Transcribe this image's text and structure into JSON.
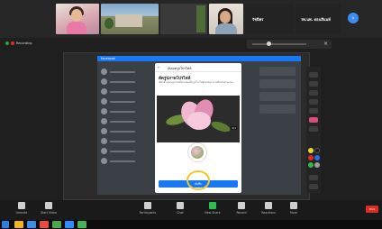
{
  "meeting": {
    "recording_label": "Recording",
    "participants": [
      {
        "name": "",
        "kind": "video"
      },
      {
        "name": "",
        "kind": "video"
      },
      {
        "name": "",
        "kind": "video"
      },
      {
        "name": "",
        "kind": "video"
      },
      {
        "name": "",
        "kind": "name-only",
        "display": "รัชนีพร"
      },
      {
        "name": "",
        "kind": "name-only",
        "display": "รพ.นพ. ดอนสีนนท์"
      }
    ],
    "next_icon": "chevron-right-icon"
  },
  "share_bar": {
    "stop_label": "Stop Share"
  },
  "web_page": {
    "top_title": "facebook",
    "modal": {
      "back_icon": "arrow-left-icon",
      "header_title": "อัปเดตรูปโปรไฟล์",
      "heading": "ตัดรูปภาพโปรไฟล์",
      "subtext": "เลือกส่วนของรูปภาพที่จะแสดงเป็นรูปโปรไฟล์ของคุณ ลากเพื่อปรับตำแหน่ง",
      "photo_counter": "1/1",
      "save_label": "บันทึก"
    }
  },
  "bottom_bar": {
    "controls": [
      {
        "label": "Unmute",
        "icon": "mic-icon"
      },
      {
        "label": "Start Video",
        "icon": "video-icon"
      },
      {
        "label": "Participants",
        "icon": "people-icon"
      },
      {
        "label": "Chat",
        "icon": "chat-icon"
      },
      {
        "label": "New Share",
        "icon": "share-icon"
      },
      {
        "label": "Record",
        "icon": "record-icon"
      },
      {
        "label": "Reactions",
        "icon": "smile-icon"
      },
      {
        "label": "More",
        "icon": "more-icon"
      }
    ],
    "end_label": "End"
  },
  "taskbar": {
    "time": "",
    "date": ""
  },
  "colors": {
    "brand_blue": "#1877f2",
    "annotation_circle": "#f3c623",
    "stop_red": "#d93025",
    "share_green": "#2dbd4e"
  }
}
